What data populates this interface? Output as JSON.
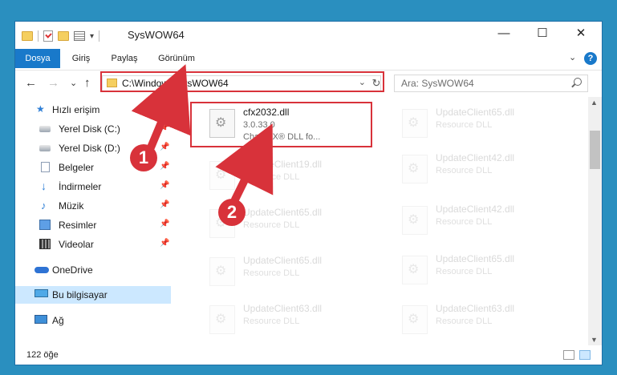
{
  "window": {
    "title": "SysWOW64",
    "minimize_glyph": "—",
    "maximize_glyph": "☐",
    "close_glyph": "✕"
  },
  "ribbon": {
    "tabs": [
      {
        "label": "Dosya",
        "active": true
      },
      {
        "label": "Giriş",
        "active": false
      },
      {
        "label": "Paylaş",
        "active": false
      },
      {
        "label": "Görünüm",
        "active": false
      }
    ],
    "collapse_glyph": "⌄",
    "help_glyph": "?"
  },
  "navigation": {
    "back_glyph": "←",
    "forward_glyph": "→",
    "recent_glyph": "⌄",
    "up_glyph": "↑"
  },
  "address": {
    "path": "C:\\Windows\\SysWOW64",
    "dropdown_glyph": "⌄",
    "refresh_glyph": "↻"
  },
  "search": {
    "placeholder": "Ara: SysWOW64"
  },
  "sidebar": {
    "items": [
      {
        "label": "Hızlı erişim",
        "icon": "star-icon",
        "pinned": false
      },
      {
        "label": "Yerel Disk (C:)",
        "icon": "drive-icon",
        "pinned": true
      },
      {
        "label": "Yerel Disk (D:)",
        "icon": "drive-icon",
        "pinned": true
      },
      {
        "label": "Belgeler",
        "icon": "documents-icon",
        "pinned": true
      },
      {
        "label": "İndirmeler",
        "icon": "downloads-icon",
        "pinned": true
      },
      {
        "label": "Müzik",
        "icon": "music-icon",
        "pinned": true
      },
      {
        "label": "Resimler",
        "icon": "pictures-icon",
        "pinned": true
      },
      {
        "label": "Videolar",
        "icon": "videos-icon",
        "pinned": true
      },
      {
        "label": "OneDrive",
        "icon": "onedrive-icon",
        "pinned": false
      },
      {
        "label": "Bu bilgisayar",
        "icon": "this-pc-icon",
        "pinned": false,
        "selected": true
      },
      {
        "label": "Ağ",
        "icon": "network-icon",
        "pinned": false
      }
    ],
    "pin_glyph": "📌"
  },
  "files": {
    "highlighted": {
      "name": "cfx2032.dll",
      "version": "3.0.33.0",
      "description": "Chart FX® DLL fo..."
    },
    "left_column": [
      {
        "name": "UpdateClient19.dll",
        "type": "Resource DLL"
      },
      {
        "name": "UpdateClient65.dll",
        "type": "Resource DLL"
      },
      {
        "name": "UpdateClient65.dll",
        "type": "Resource DLL"
      },
      {
        "name": "UpdateClient63.dll",
        "type": "Resource DLL"
      }
    ],
    "right_column": [
      {
        "name": "UpdateClient65.dll",
        "type": "Resource DLL"
      },
      {
        "name": "UpdateClient42.dll",
        "type": "Resource DLL"
      },
      {
        "name": "UpdateClient42.dll",
        "type": "Resource DLL"
      },
      {
        "name": "UpdateClient65.dll",
        "type": "Resource DLL"
      },
      {
        "name": "UpdateClient63.dll",
        "type": "Resource DLL"
      }
    ]
  },
  "status": {
    "item_count": "122 öğe"
  },
  "callouts": {
    "step1": "1",
    "step2": "2",
    "color": "#d8323a"
  },
  "colors": {
    "accent": "#1979ca",
    "highlight": "#d8323a",
    "selected_nav": "#cce8ff"
  }
}
